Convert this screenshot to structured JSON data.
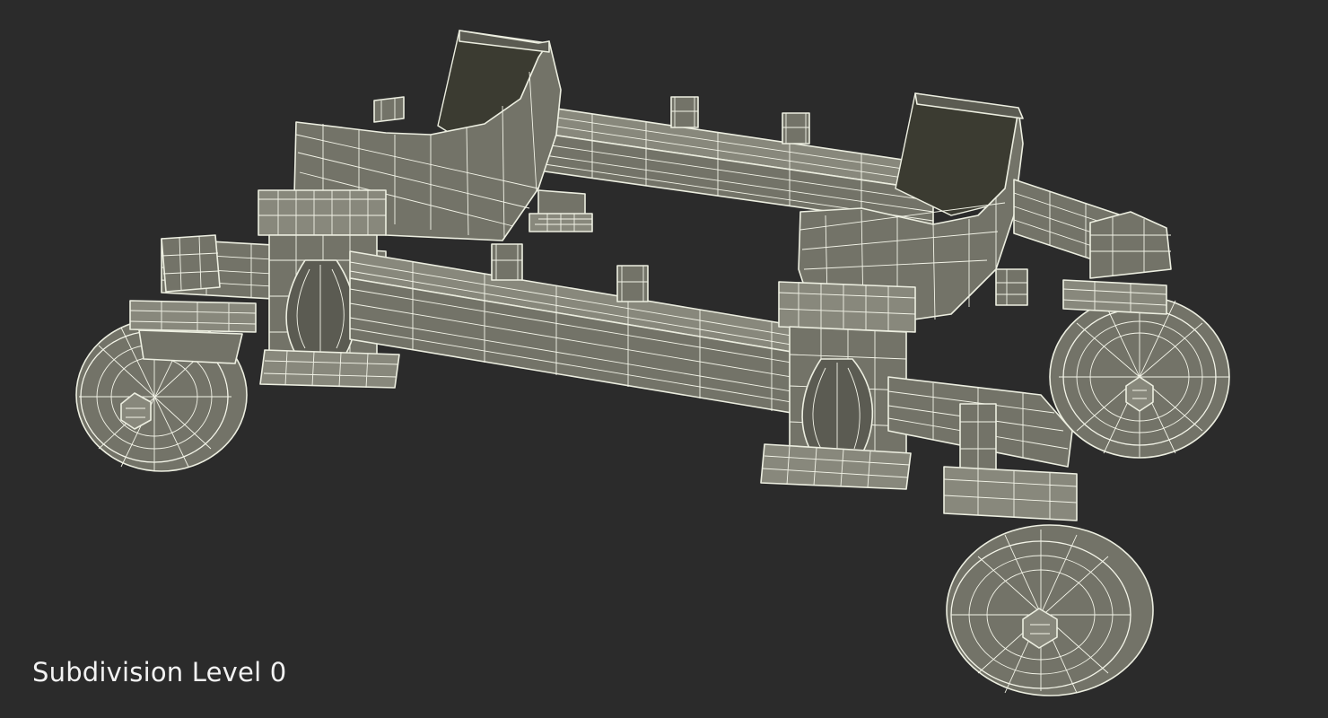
{
  "caption": "Subdivision Level 0",
  "colors": {
    "background": "#2b2b2b",
    "model_fill": "#737368",
    "wireframe": "#eceee0"
  }
}
